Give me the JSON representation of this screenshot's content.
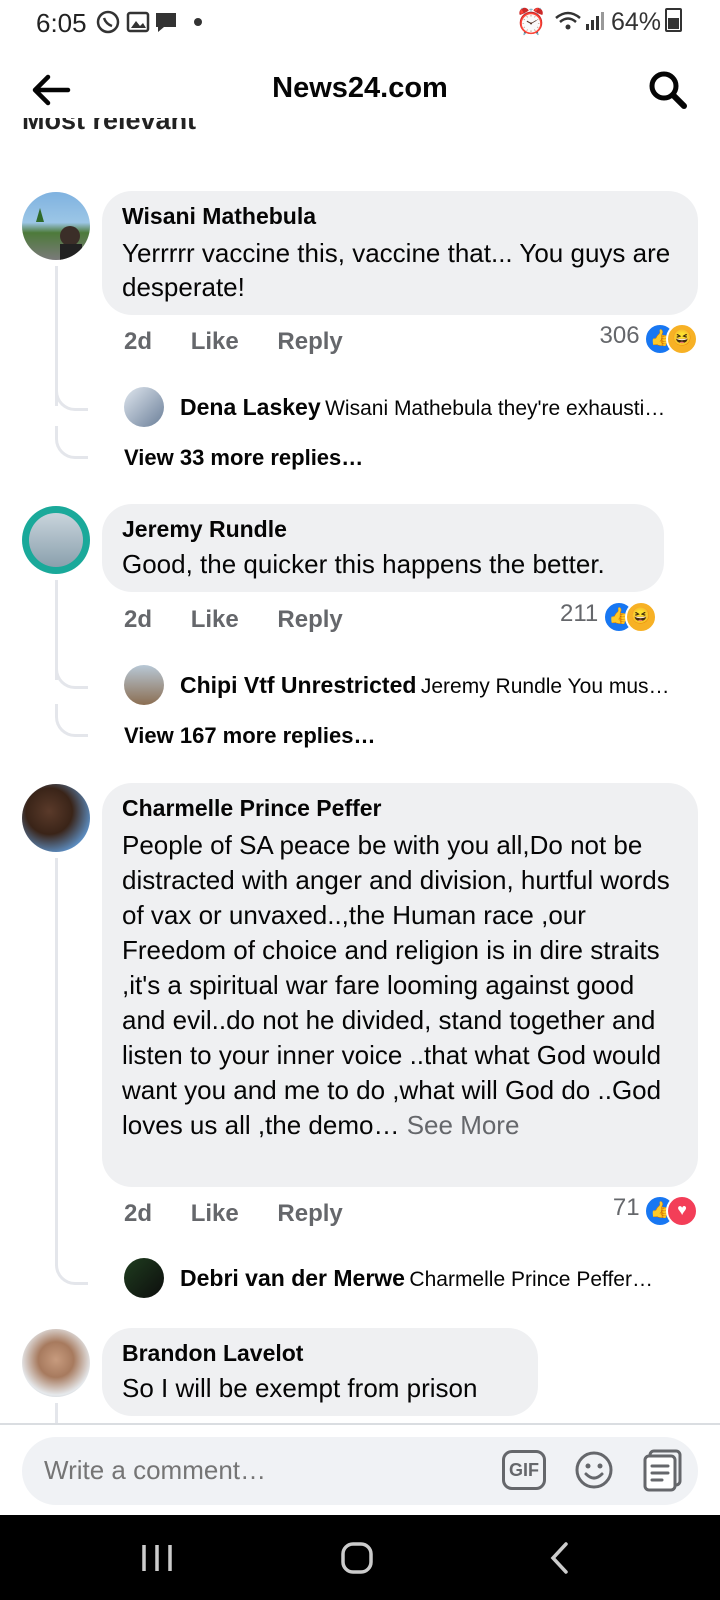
{
  "status_bar": {
    "time": "6:05",
    "battery": "64%"
  },
  "header": {
    "title": "News24.com"
  },
  "section_label": "Most relevant",
  "comments": [
    {
      "author": "Wisani Mathebula",
      "text": "Yerrrrr vaccine this, vaccine that... You guys are desperate!",
      "age": "2d",
      "like": "Like",
      "reply": "Reply",
      "reaction_count": "306",
      "reactions": [
        "like",
        "haha"
      ],
      "reply_preview": {
        "name": "Dena Laskey",
        "text": "Wisani Mathebula they're exhausti…"
      },
      "view_more": "View 33 more replies…"
    },
    {
      "author": "Jeremy Rundle",
      "text": "Good, the quicker this happens the better.",
      "age": "2d",
      "like": "Like",
      "reply": "Reply",
      "reaction_count": "211",
      "reactions": [
        "like",
        "haha"
      ],
      "reply_preview": {
        "name": "Chipi Vtf Unrestricted",
        "text": "Jeremy Rundle You mus…"
      },
      "view_more": "View 167 more replies…"
    },
    {
      "author": "Charmelle Prince Peffer",
      "text": "People of SA peace be with you all,Do not be distracted with anger and division, hurtful words of vax or unvaxed..,the  Human race ,our Freedom of choice and religion is in dire straits ,it's a spiritual war fare looming against good and evil..do not he divided, stand together and listen to your inner voice ..that what God would want you and me to do ,what will God do ..God  loves us all ,the demo…",
      "see_more": "See More",
      "age": "2d",
      "like": "Like",
      "reply": "Reply",
      "reaction_count": "71",
      "reactions": [
        "like",
        "love"
      ],
      "reply_preview": {
        "name": "Debri van der Merwe",
        "text": "Charmelle Prince Peffer…"
      }
    },
    {
      "author": "Brandon Lavelot",
      "text": "So I will be exempt from prison"
    }
  ],
  "composer": {
    "placeholder": "Write a comment…",
    "gif_label": "GIF"
  },
  "colors": {
    "accent": "#1877f2",
    "bubble": "#eff0f2",
    "meta": "#65676b"
  }
}
